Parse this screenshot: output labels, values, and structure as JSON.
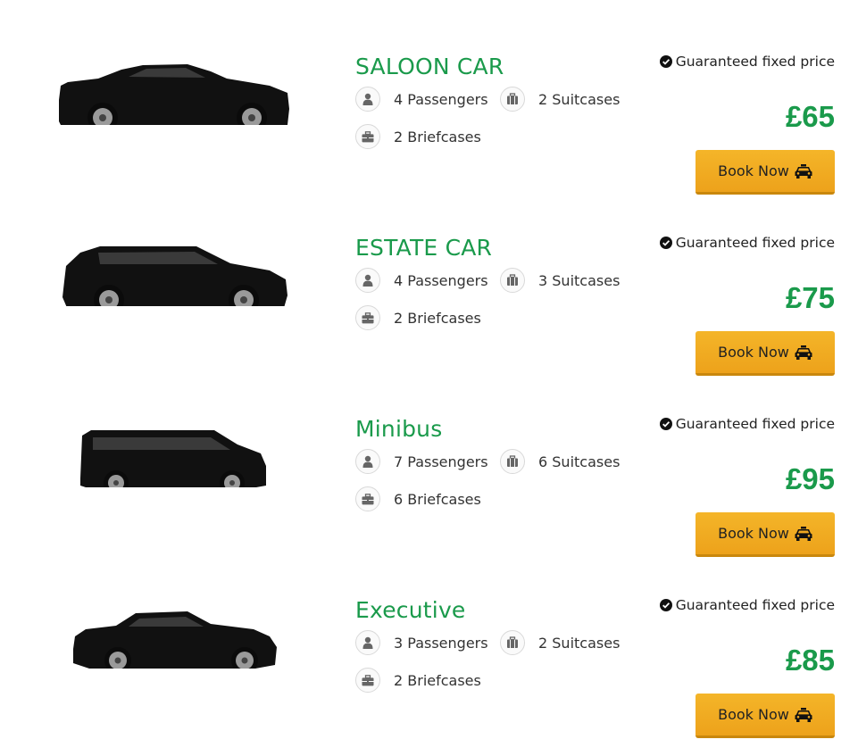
{
  "guarantee_text": "Guaranteed fixed price",
  "book_label": "Book Now",
  "vehicles": [
    {
      "name": "SALOON CAR",
      "passengers": "4 Passengers",
      "suitcases": "2 Suitcases",
      "briefcases": "2 Briefcases",
      "price": "£65"
    },
    {
      "name": "ESTATE CAR",
      "passengers": "4 Passengers",
      "suitcases": "3 Suitcases",
      "briefcases": "2 Briefcases",
      "price": "£75"
    },
    {
      "name": "Minibus",
      "passengers": "7 Passengers",
      "suitcases": "6 Suitcases",
      "briefcases": "6 Briefcases",
      "price": "£95"
    },
    {
      "name": "Executive",
      "passengers": "3 Passengers",
      "suitcases": "2 Suitcases",
      "briefcases": "2 Briefcases",
      "price": "£85"
    }
  ],
  "colors": {
    "accent_green": "#1a9a4b",
    "button_orange": "#f0a821"
  },
  "icons": {
    "passengers": "user-icon",
    "suitcases": "suitcase-icon",
    "briefcases": "briefcase-icon",
    "guarantee": "check-circle-icon",
    "book": "taxi-icon"
  }
}
